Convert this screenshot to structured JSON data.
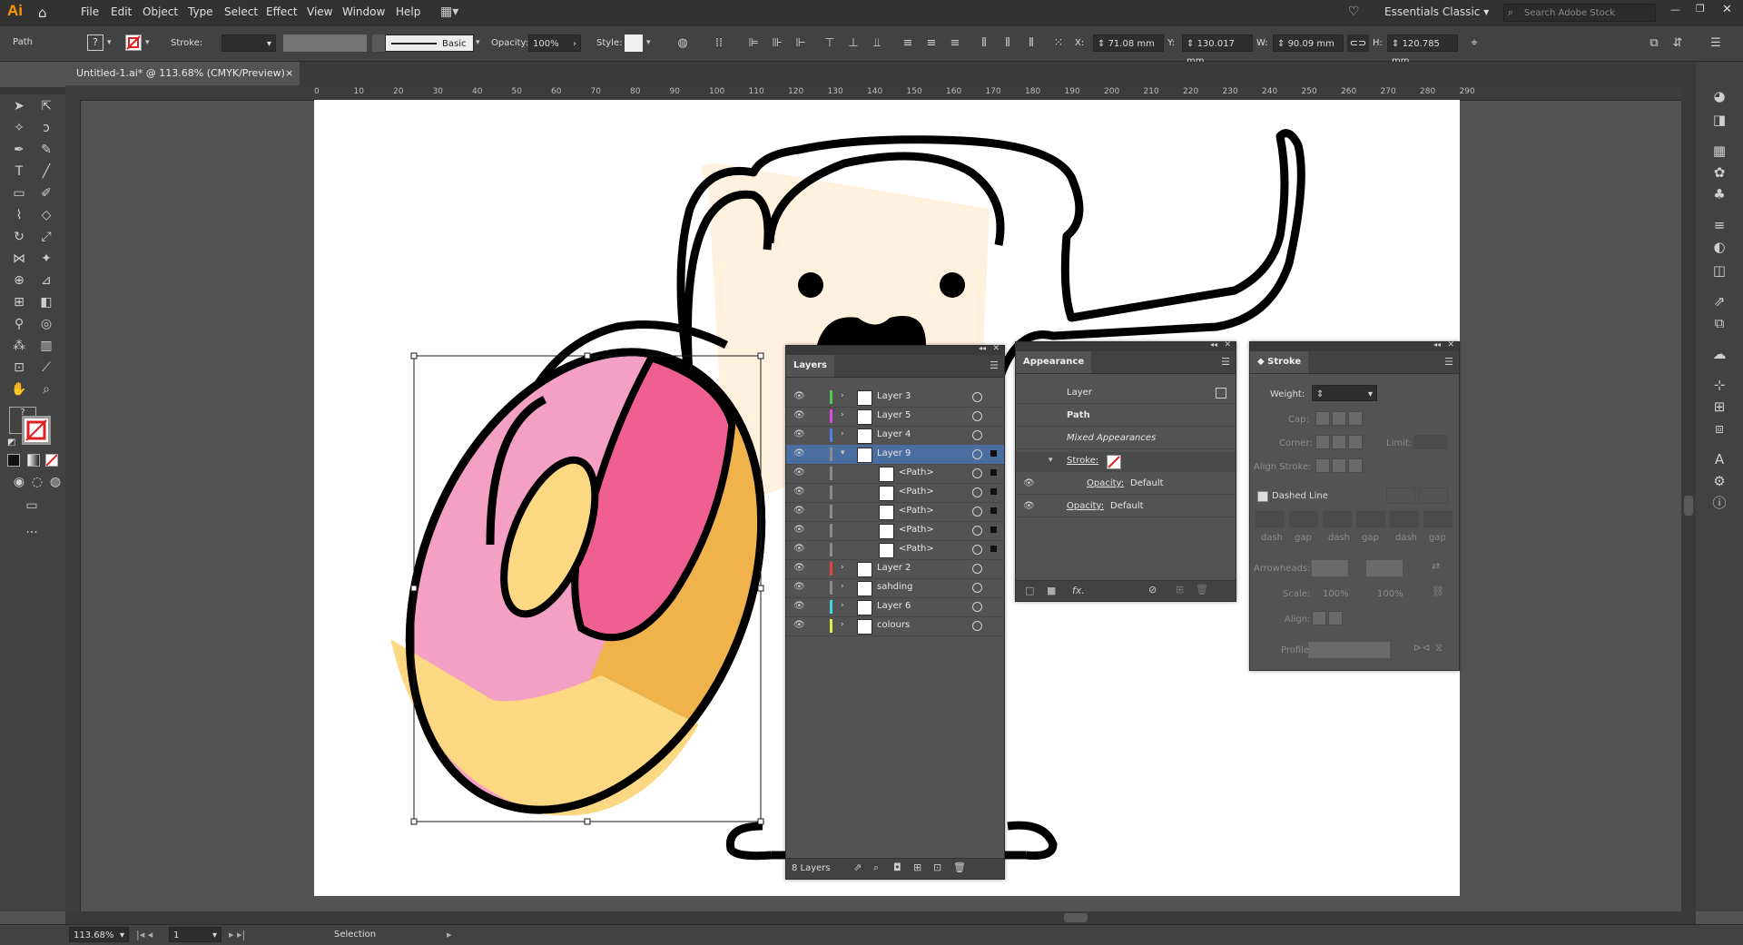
{
  "app": {
    "logo": "Ai"
  },
  "menu": [
    "File",
    "Edit",
    "Object",
    "Type",
    "Select",
    "Effect",
    "View",
    "Window",
    "Help"
  ],
  "workspace": {
    "name": "Essentials Classic",
    "search_placeholder": "Search Adobe Stock"
  },
  "control": {
    "object_type": "Path",
    "stroke_label": "Stroke:",
    "brush_label": "Basic",
    "opacity_label": "Opacity:",
    "opacity_value": "100%",
    "style_label": "Style:",
    "x_label": "X:",
    "x_value": "71.08 mm",
    "y_label": "Y:",
    "y_value": "130.017 mm",
    "w_label": "W:",
    "w_value": "90.09 mm",
    "h_label": "H:",
    "h_value": "120.785 mm"
  },
  "document": {
    "tab_title": "Untitled-1.ai* @ 113.68% (CMYK/Preview)",
    "close": "×"
  },
  "ruler": {
    "h_ticks": [
      "0",
      "10",
      "20",
      "30",
      "40",
      "50",
      "60",
      "70",
      "80",
      "90",
      "100",
      "110",
      "120",
      "130",
      "140",
      "150",
      "160",
      "170",
      "180",
      "190",
      "200",
      "210",
      "220",
      "230",
      "240",
      "250",
      "260",
      "270",
      "280",
      "290"
    ]
  },
  "colors": {
    "pink": "#f4a0c5",
    "hotpink": "#ef5f92",
    "orange": "#f0b24b",
    "yellow": "#fdd882",
    "cream": "#fff1dd",
    "selection": "#4b6ea0"
  },
  "layers_panel": {
    "title": "Layers",
    "rows": [
      {
        "name": "Layer 3",
        "color": "#4fc94f",
        "expanded": false,
        "indent": 0
      },
      {
        "name": "Layer 5",
        "color": "#d94fd9",
        "expanded": false,
        "indent": 0
      },
      {
        "name": "Layer 4",
        "color": "#4f7fe6",
        "expanded": false,
        "indent": 0
      },
      {
        "name": "Layer 9",
        "color": "#8c8c8c",
        "expanded": true,
        "indent": 0,
        "selected": true
      },
      {
        "name": "<Path>",
        "color": "#8c8c8c",
        "indent": 1
      },
      {
        "name": "<Path>",
        "color": "#8c8c8c",
        "indent": 1
      },
      {
        "name": "<Path>",
        "color": "#8c8c8c",
        "indent": 1
      },
      {
        "name": "<Path>",
        "color": "#8c8c8c",
        "indent": 1
      },
      {
        "name": "<Path>",
        "color": "#8c8c8c",
        "indent": 1
      },
      {
        "name": "Layer 2",
        "color": "#e04545",
        "expanded": false,
        "indent": 0
      },
      {
        "name": "sahding",
        "color": "#8c8c8c",
        "expanded": false,
        "indent": 0
      },
      {
        "name": "Layer 6",
        "color": "#45d4e8",
        "expanded": false,
        "indent": 0
      },
      {
        "name": "colours",
        "color": "#e8e845",
        "expanded": false,
        "indent": 0
      }
    ],
    "footer": "8 Layers"
  },
  "appearance_panel": {
    "title": "Appearance",
    "layer_label": "Layer",
    "path_label": "Path",
    "mixed_label": "Mixed Appearances",
    "stroke_label": "Stroke:",
    "opacity1": "Opacity:",
    "opacity1_value": "Default",
    "opacity2": "Opacity:",
    "opacity2_value": "Default",
    "fx": "fx."
  },
  "stroke_panel": {
    "title": "Stroke",
    "weight_label": "Weight:",
    "cap_label": "Cap:",
    "corner_label": "Corner:",
    "limit_label": "Limit:",
    "align_label": "Align Stroke:",
    "dashed_label": "Dashed Line",
    "dash_labels": [
      "dash",
      "gap",
      "dash",
      "gap",
      "dash",
      "gap"
    ],
    "arrowheads_label": "Arrowheads:",
    "scale_label": "Scale:",
    "scale1": "100%",
    "scale2": "100%",
    "align2_label": "Align:",
    "profile_label": "Profile:"
  },
  "status": {
    "zoom": "113.68%",
    "page": "1",
    "tool": "Selection"
  }
}
